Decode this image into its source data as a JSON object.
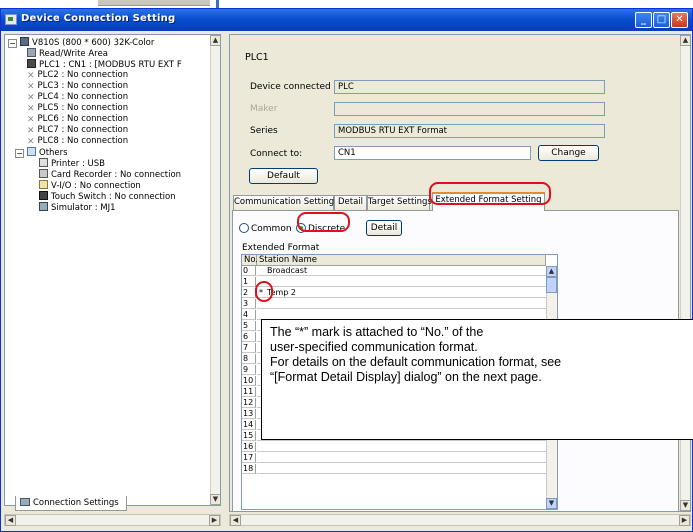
{
  "window": {
    "title": "Device Connection Setting"
  },
  "tree": {
    "items": [
      {
        "label": "V810S (800 * 600) 32K-Color"
      },
      {
        "label": "Read/Write Area"
      },
      {
        "label": "PLC1 : CN1 : [MODBUS RTU EXT F"
      },
      {
        "label": "PLC2 : No connection"
      },
      {
        "label": "PLC3 : No connection"
      },
      {
        "label": "PLC4 : No connection"
      },
      {
        "label": "PLC5 : No connection"
      },
      {
        "label": "PLC6 : No connection"
      },
      {
        "label": "PLC7 : No connection"
      },
      {
        "label": "PLC8 : No connection"
      },
      {
        "label": "Others"
      },
      {
        "label": "Printer : USB"
      },
      {
        "label": "Card Recorder : No connection"
      },
      {
        "label": "V-I/O : No connection"
      },
      {
        "label": "Touch Switch : No connection"
      },
      {
        "label": "Simulator : MJ1"
      }
    ],
    "bottom_tab": "Connection Settings"
  },
  "plc": {
    "title": "PLC1",
    "device_connected_label": "Device connected",
    "device_connected_value": "PLC",
    "maker_label": "Maker",
    "maker_value": "",
    "series_label": "Series",
    "series_value": "MODBUS RTU EXT Format",
    "connect_to_label": "Connect to:",
    "connect_to_value": "CN1",
    "change_button": "Change",
    "default_button": "Default"
  },
  "tabs": [
    {
      "label": "Communication Setting"
    },
    {
      "label": "Detail"
    },
    {
      "label": "Target Settings"
    },
    {
      "label": "Extended Format Setting"
    }
  ],
  "format": {
    "common_label": "Common",
    "discrete_label": "Discrete",
    "selected": "Discrete",
    "detail_button": "Detail",
    "extended_format_label": "Extended Format",
    "col_no": "No.",
    "col_station": "Station Name",
    "rows": [
      {
        "no": "0",
        "mark": "",
        "name": "Broadcast"
      },
      {
        "no": "1",
        "mark": "",
        "name": ""
      },
      {
        "no": "2",
        "mark": "*",
        "name": "Temp 2"
      },
      {
        "no": "3",
        "mark": "",
        "name": ""
      },
      {
        "no": "4",
        "mark": "",
        "name": ""
      },
      {
        "no": "5",
        "mark": "",
        "name": ""
      },
      {
        "no": "6",
        "mark": "",
        "name": ""
      },
      {
        "no": "7",
        "mark": "",
        "name": ""
      },
      {
        "no": "8",
        "mark": "",
        "name": ""
      },
      {
        "no": "9",
        "mark": "",
        "name": ""
      },
      {
        "no": "10",
        "mark": "",
        "name": ""
      },
      {
        "no": "11",
        "mark": "",
        "name": ""
      },
      {
        "no": "12",
        "mark": "",
        "name": ""
      },
      {
        "no": "13",
        "mark": "",
        "name": ""
      },
      {
        "no": "14",
        "mark": "",
        "name": ""
      },
      {
        "no": "15",
        "mark": "",
        "name": ""
      },
      {
        "no": "16",
        "mark": "",
        "name": ""
      },
      {
        "no": "17",
        "mark": "",
        "name": ""
      },
      {
        "no": "18",
        "mark": "",
        "name": ""
      }
    ]
  },
  "callout": {
    "line1": "The “*” mark is attached to “No.” of the",
    "line2": "user-specified communication format.",
    "line3": "For details on the default communication format, see",
    "line4": "“[Format Detail Display] dialog” on the next page."
  },
  "colors": {
    "highlight": "#e0101a",
    "titlebar": "#0a4fd0"
  }
}
